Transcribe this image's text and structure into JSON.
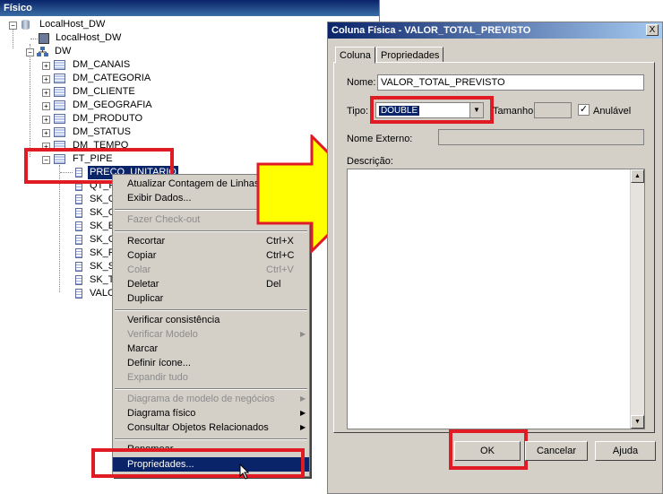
{
  "panel": {
    "title": "Físico"
  },
  "tree": {
    "root": "LocalHost_DW",
    "server": "LocalHost_DW",
    "schema": "DW",
    "tables": [
      "DM_CANAIS",
      "DM_CATEGORIA",
      "DM_CLIENTE",
      "DM_GEOGRAFIA",
      "DM_PRODUTO",
      "DM_STATUS",
      "DM_TEMPO"
    ],
    "fact_table": "FT_PIPE",
    "columns": [
      "PRECO_UNITARIO",
      "QT_P",
      "SK_C",
      "SK_C",
      "SK_E",
      "SK_G",
      "SK_P",
      "SK_S",
      "SK_T",
      "VALC"
    ]
  },
  "context_menu": {
    "items": [
      {
        "label": "Atualizar Contagem de Linhas",
        "shortcut": "",
        "disabled": false
      },
      {
        "label": "Exibir Dados...",
        "shortcut": "",
        "disabled": false
      },
      {
        "label": "Fazer Check-out",
        "shortcut": "",
        "disabled": true
      },
      {
        "label": "Recortar",
        "shortcut": "Ctrl+X",
        "disabled": false
      },
      {
        "label": "Copiar",
        "shortcut": "Ctrl+C",
        "disabled": false
      },
      {
        "label": "Colar",
        "shortcut": "Ctrl+V",
        "disabled": true
      },
      {
        "label": "Deletar",
        "shortcut": "Del",
        "disabled": false
      },
      {
        "label": "Duplicar",
        "shortcut": "",
        "disabled": false
      },
      {
        "label": "Verificar consistência",
        "shortcut": "",
        "disabled": false
      },
      {
        "label": "Verificar Modelo",
        "shortcut": "",
        "disabled": true
      },
      {
        "label": "Marcar",
        "shortcut": "",
        "disabled": false
      },
      {
        "label": "Definir ícone...",
        "shortcut": "",
        "disabled": false
      },
      {
        "label": "Expandir tudo",
        "shortcut": "",
        "disabled": true
      },
      {
        "label": "Diagrama de modelo de negócios",
        "shortcut": "",
        "disabled": true
      },
      {
        "label": "Diagrama físico",
        "shortcut": "",
        "disabled": false
      },
      {
        "label": "Consultar Objetos Relacionados",
        "shortcut": "",
        "disabled": false
      },
      {
        "label": "Renomear",
        "shortcut": "",
        "disabled": false
      },
      {
        "label": "Propriedades...",
        "shortcut": "",
        "disabled": false
      }
    ]
  },
  "dialog": {
    "title": "Coluna Física - VALOR_TOTAL_PREVISTO",
    "close": "X",
    "tabs": [
      "Coluna",
      "Propriedades"
    ],
    "name_label": "Nome:",
    "name_value": "VALOR_TOTAL_PREVISTO",
    "type_label": "Tipo:",
    "type_value": "DOUBLE",
    "size_label": "Tamanho:",
    "nullable_label": "Anulável",
    "nullable_checked": "✓",
    "external_name_label": "Nome Externo:",
    "description_label": "Descrição:",
    "ok": "OK",
    "cancel": "Cancelar",
    "help": "Ajuda"
  },
  "colors": {
    "highlight_red": "#e01b24",
    "arrow_yellow": "#ffff00",
    "selection": "#0a246a"
  }
}
